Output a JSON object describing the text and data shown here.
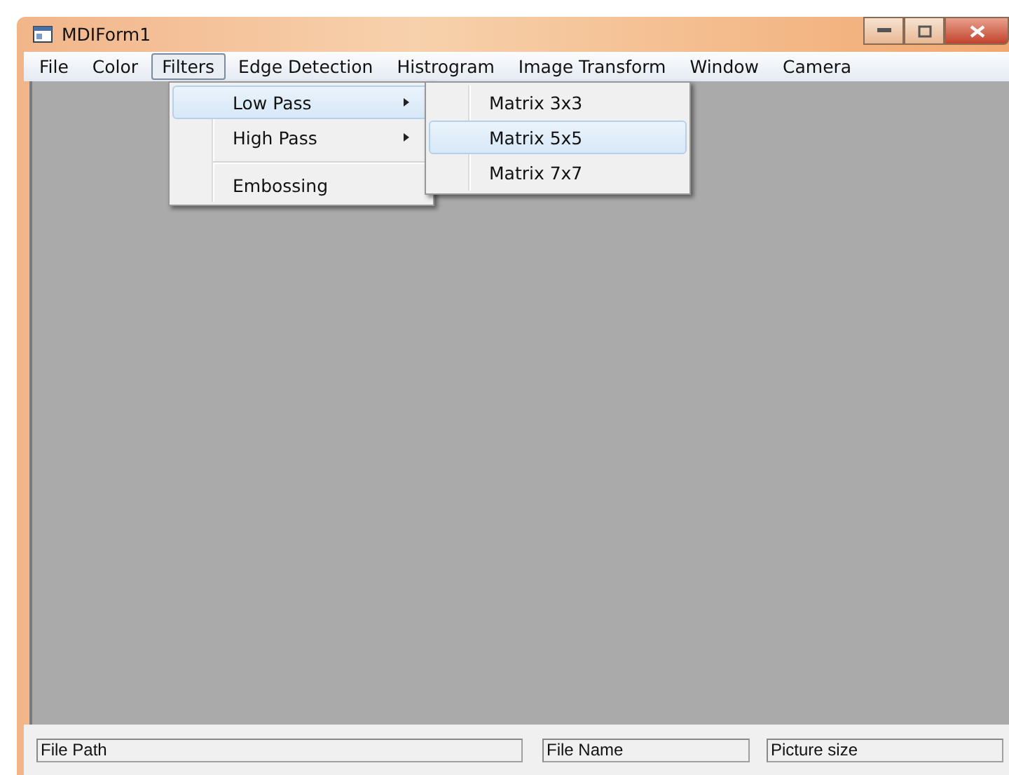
{
  "window": {
    "title": "MDIForm1"
  },
  "menu_bar": [
    {
      "label": "File",
      "selected": false
    },
    {
      "label": "Color",
      "selected": false
    },
    {
      "label": "Filters",
      "selected": true
    },
    {
      "label": "Edge Detection",
      "selected": false
    },
    {
      "label": "Histrogram",
      "selected": false
    },
    {
      "label": "Image Transform",
      "selected": false
    },
    {
      "label": "Window",
      "selected": false
    },
    {
      "label": "Camera",
      "selected": false
    }
  ],
  "filters_menu": [
    {
      "label": "Low Pass",
      "selected": true,
      "has_submenu": true,
      "separator_before": false
    },
    {
      "label": "High Pass",
      "selected": false,
      "has_submenu": true,
      "separator_before": false
    },
    {
      "label": "Embossing",
      "selected": false,
      "has_submenu": false,
      "separator_before": true
    }
  ],
  "low_pass_submenu": [
    {
      "label": "Matrix 3x3",
      "selected": false,
      "has_submenu": false,
      "separator_before": false
    },
    {
      "label": "Matrix 5x5",
      "selected": true,
      "has_submenu": false,
      "separator_before": false
    },
    {
      "label": "Matrix 7x7",
      "selected": false,
      "has_submenu": false,
      "separator_before": false
    }
  ],
  "status_bar": [
    {
      "text": "File Path"
    },
    {
      "text": "File Name"
    },
    {
      "text": "Picture size"
    }
  ]
}
